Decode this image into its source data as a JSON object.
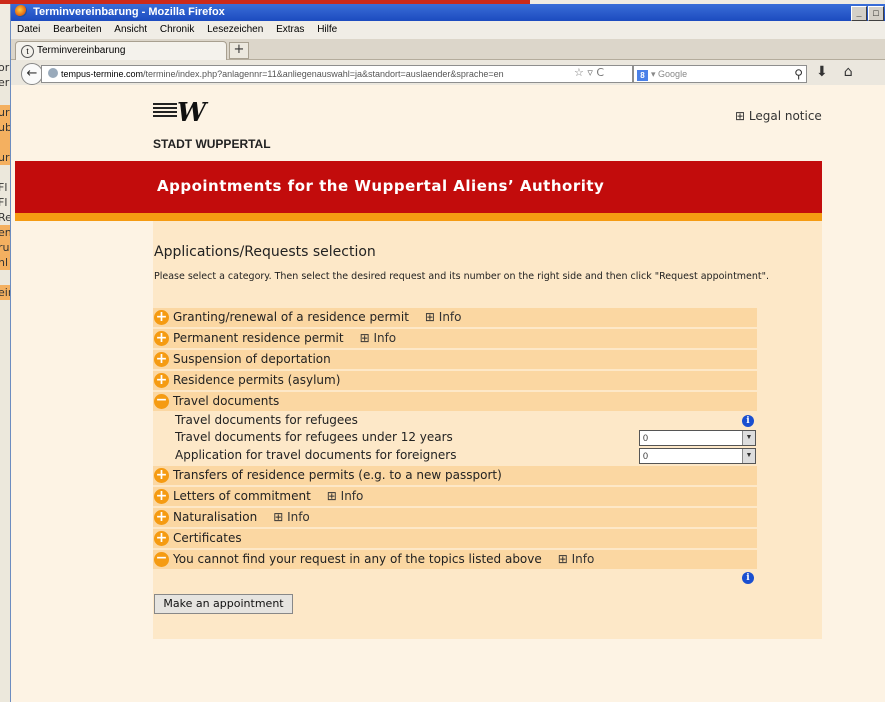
{
  "browser": {
    "window_title": "Terminvereinbarung - Mozilla Firefox",
    "window_buttons": [
      "_",
      "□"
    ],
    "menu": [
      "Datei",
      "Bearbeiten",
      "Ansicht",
      "Chronik",
      "Lesezeichen",
      "Extras",
      "Hilfe"
    ],
    "tab_title": "Terminvereinbarung",
    "tab_icon": "t",
    "new_tab": "+",
    "url_host": "tempus-termine.com",
    "url_path": "/termine/index.php?anlagennr=11&anliegenauswahl=ja&standort=auslaender&sprache=en",
    "search_placeholder": "Google",
    "search_engine": "8"
  },
  "background_window": {
    "side_text": [
      "ori",
      "er",
      "",
      "ur",
      "ub",
      "",
      "ur",
      "",
      "Fl",
      "Fl",
      "Re",
      "en",
      "ru",
      "nl",
      "",
      "eir"
    ]
  },
  "page": {
    "brand": "STADT WUPPERTAL",
    "legal_notice": "Legal notice",
    "header_title": "Appointments for the Wuppertal Aliens’ Authority",
    "section_title": "Applications/Requests selection",
    "instructions": "Please select a category. Then select the desired request and its number on the right side and then click \"Request appointment\".",
    "categories": [
      {
        "label": "Granting/renewal of a residence permit",
        "info": "Info",
        "expanded": false
      },
      {
        "label": "Permanent residence permit",
        "info": "Info",
        "expanded": false
      },
      {
        "label": "Suspension of deportation",
        "expanded": false
      },
      {
        "label": "Residence permits (asylum)",
        "expanded": false
      },
      {
        "label": "Travel documents",
        "expanded": true
      },
      {
        "label": "Transfers of residence permits (e.g. to a new passport)",
        "expanded": false
      },
      {
        "label": "Letters of commitment",
        "info": "Info",
        "expanded": false
      },
      {
        "label": "Naturalisation",
        "info": "Info",
        "expanded": false
      },
      {
        "label": "Certificates",
        "expanded": false
      },
      {
        "label": "You cannot find your request in any of the topics listed above",
        "info": "Info",
        "expanded": false
      }
    ],
    "sub_requests": [
      {
        "label": "Travel documents for refugees"
      },
      {
        "label": "Travel documents for refugees under 12 years",
        "value": "0"
      },
      {
        "label": "Application for travel documents for foreigners",
        "value": "0"
      }
    ],
    "button_label": "Make an appointment"
  },
  "colors": {
    "header_red": "#c20c0c",
    "accent_orange": "#f59b12",
    "row_bg": "#fbd7a2",
    "panel_bg": "#fde8c8",
    "page_bg": "#fdf3e4"
  }
}
